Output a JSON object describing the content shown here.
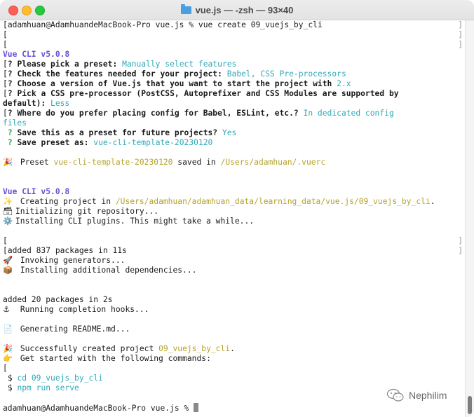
{
  "window": {
    "title": "vue.js — -zsh — 93×40",
    "title_icon": "folder-icon"
  },
  "terminal": {
    "prompt": "adamhuan@AdamhuandeMacBook-Pro vue.js %",
    "command": "vue create 09_vuejs_by_cli",
    "vue_cli_version": "Vue CLI v5.0.8",
    "questions": [
      {
        "q": "Please pick a preset:",
        "a": "Manually select features"
      },
      {
        "q": "Check the features needed for your project:",
        "a": "Babel, CSS Pre-processors"
      },
      {
        "q": "Choose a version of Vue.js that you want to start the project with",
        "a": "2.x"
      },
      {
        "q1": "Pick a CSS pre-processor (PostCSS, Autoprefixer and CSS Modules are supported by",
        "q2": "default):",
        "a": "Less"
      },
      {
        "q": "Where do you prefer placing config for Babel, ESLint, etc.?",
        "a1": "In dedicated config",
        "a2": "files"
      },
      {
        "q": "Save this as a preset for future projects?",
        "a": "Yes"
      },
      {
        "q": "Save preset as:",
        "a": "vue-cli-template-20230120"
      }
    ],
    "preset_saved": {
      "prefix": "Preset",
      "name": "vue-cli-template-20230120",
      "middle": "saved in",
      "path": "/Users/adamhuan/.vuerc"
    },
    "creating": {
      "prefix": "Creating project in",
      "path": "/Users/adamhuan/adamhuan_data/learning_data/vue.js/09_vuejs_by_cli",
      "suffix": "."
    },
    "init_git": "Initializing git repository...",
    "install_plugins": "Installing CLI plugins. This might take a while...",
    "added1": "added 837 packages in 11s",
    "invoking": "Invoking generators...",
    "installing_deps": "Installing additional dependencies...",
    "added2": "added 20 packages in 2s",
    "completion_hooks": "Running completion hooks...",
    "readme": "Generating README.md...",
    "success": {
      "prefix": "Successfully created project",
      "name": "09_vuejs_by_cli",
      "suffix": "."
    },
    "get_started": "Get started with the following commands:",
    "cmd_cd": "cd 09_vuejs_by_cli",
    "cmd_serve": "npm run serve",
    "shell_symbol": "$",
    "prompt_marker": "?",
    "line_bracket_open": "[",
    "line_bracket_close": "]",
    "emoji": {
      "party": "🎉",
      "sparkles": "✨",
      "git": "🗃",
      "gear": "⚙️",
      "rocket": "🚀",
      "package": "📦",
      "anchor": "⚓",
      "page": "📄",
      "point": "👉"
    }
  },
  "watermark": {
    "text": "Nephilim",
    "icon": "wechat-icon"
  },
  "colors": {
    "cyan": "#2fa8b8",
    "yellow": "#b5a32a",
    "purple": "#6c4fd6",
    "green_prompt": "#1f9e4a"
  }
}
